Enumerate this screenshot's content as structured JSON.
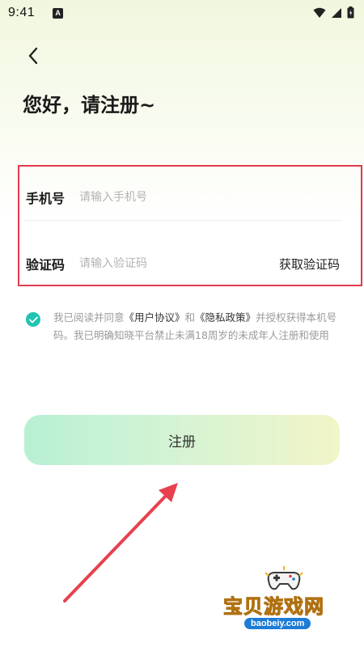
{
  "status_bar": {
    "time": "9:41",
    "notification_letter": "A"
  },
  "header": {
    "title": "您好，请注册~"
  },
  "form": {
    "phone": {
      "label": "手机号",
      "placeholder": "请输入手机号"
    },
    "code": {
      "label": "验证码",
      "placeholder": "请输入验证码",
      "get_code_label": "获取验证码"
    }
  },
  "agreement": {
    "checked": true,
    "text_prefix": "我已阅读并同意",
    "user_agreement": "《用户协议》",
    "and": "和",
    "privacy_policy": "《隐私政策》",
    "text_suffix": "并授权获得本机号码。我已明确知晓平台禁止未满18周岁的未成年人注册和使用"
  },
  "register_button": {
    "label": "注册"
  },
  "watermark": {
    "title": "宝贝游戏网",
    "url": "baobeiy.com"
  },
  "colors": {
    "highlight_box": "#e23a4c",
    "checkbox": "#22c3b0",
    "arrow": "#e8404f"
  }
}
